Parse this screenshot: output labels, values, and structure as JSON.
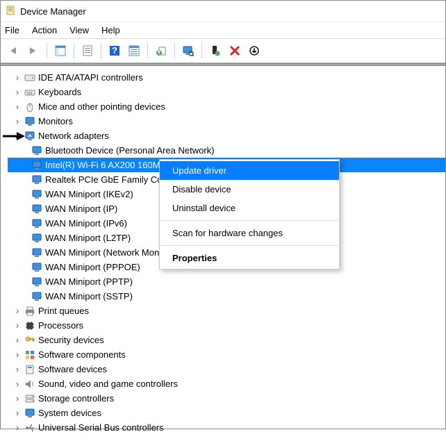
{
  "window": {
    "title": "Device Manager"
  },
  "menu": {
    "file": "File",
    "action": "Action",
    "view": "View",
    "help": "Help"
  },
  "categories": {
    "c0": "IDE ATA/ATAPI controllers",
    "c1": "Keyboards",
    "c2": "Mice and other pointing devices",
    "c3": "Monitors",
    "c4": "Network adapters",
    "c5": "Print queues",
    "c6": "Processors",
    "c7": "Security devices",
    "c8": "Software components",
    "c9": "Software devices",
    "c10": "Sound, video and game controllers",
    "c11": "Storage controllers",
    "c12": "System devices",
    "c13": "Universal Serial Bus controllers"
  },
  "adapters": {
    "a0": "Bluetooth Device (Personal Area Network)",
    "a1": "Intel(R) Wi-Fi 6 AX200 160MHz",
    "a2": "Realtek PCIe GbE Family Controller",
    "a3": "WAN Miniport (IKEv2)",
    "a4": "WAN Miniport (IP)",
    "a5": "WAN Miniport (IPv6)",
    "a6": "WAN Miniport (L2TP)",
    "a7": "WAN Miniport (Network Monitor)",
    "a8": "WAN Miniport (PPPOE)",
    "a9": "WAN Miniport (PPTP)",
    "a10": "WAN Miniport (SSTP)"
  },
  "context": {
    "update": "Update driver",
    "disable": "Disable device",
    "uninstall": "Uninstall device",
    "scan": "Scan for hardware changes",
    "properties": "Properties"
  }
}
